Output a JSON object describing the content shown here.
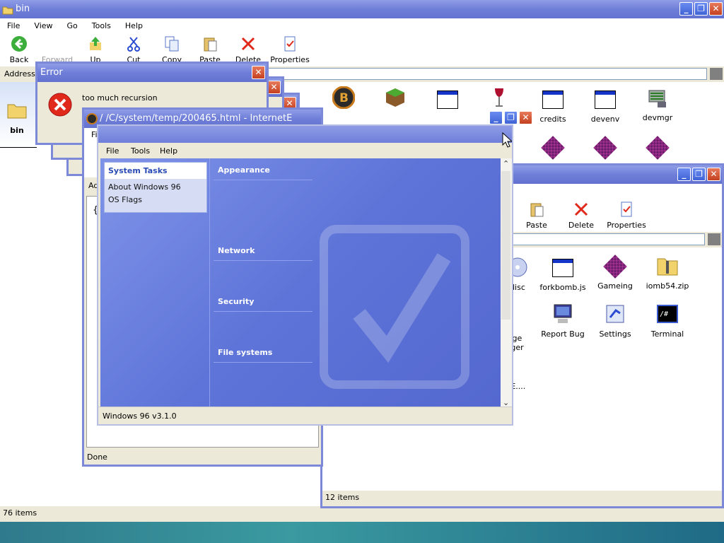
{
  "bin": {
    "title": "bin",
    "menu": [
      "File",
      "View",
      "Go",
      "Tools",
      "Help"
    ],
    "toolbar": {
      "back": "Back",
      "forward": "Forward",
      "up": "Up",
      "cut": "Cut",
      "copy": "Copy",
      "paste": "Paste",
      "delete": "Delete",
      "properties": "Properties"
    },
    "address_label": "Address",
    "sidebar_folder": "bin",
    "icons": [
      {
        "label": "credits"
      },
      {
        "label": "devenv"
      },
      {
        "label": "devmgr"
      }
    ],
    "status": "76 items"
  },
  "second": {
    "toolbar": {
      "paste": "Paste",
      "delete": "Delete",
      "properties": "Properties"
    },
    "icons": [
      {
        "label": "disc"
      },
      {
        "label": "forkbomb.js"
      },
      {
        "label": "Gameing"
      },
      {
        "label": "iomb54.zip"
      },
      {
        "label": "age\nnger"
      },
      {
        "label": "Report Bug"
      },
      {
        "label": "Settings"
      },
      {
        "label": "Terminal"
      },
      {
        "label": "ME...."
      }
    ],
    "status": "12 items"
  },
  "error": {
    "title": "Error",
    "message": "too much recursion"
  },
  "ie": {
    "title": "/ /C/system/temp/200465.html - InternetE",
    "menu_partial": "Fi",
    "address_partial": "Ad",
    "content_char": "{",
    "status": "Done"
  },
  "settings": {
    "menu": [
      "File",
      "Tools",
      "Help"
    ],
    "tasks_header": "System Tasks",
    "tasks": [
      "About Windows 96",
      "OS Flags"
    ],
    "sections": [
      "Appearance",
      "Network",
      "Security",
      "File systems"
    ],
    "status": "Windows 96 v3.1.0"
  }
}
